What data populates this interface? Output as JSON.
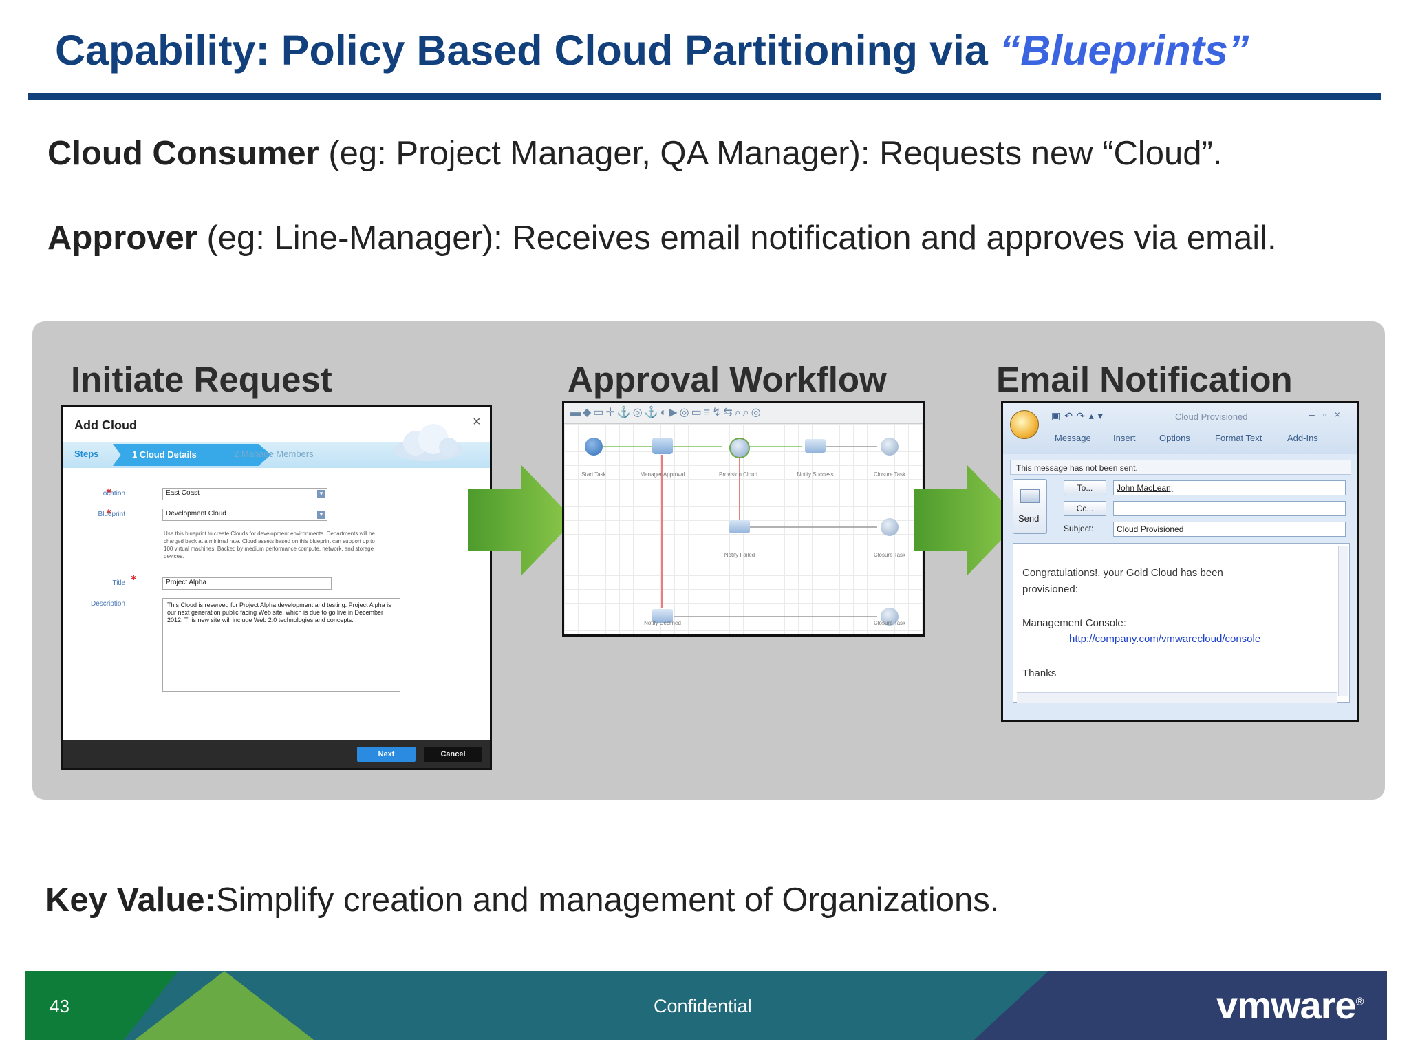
{
  "slide": {
    "title_main": "Capability: Policy Based Cloud Partitioning via ",
    "title_highlight": "“Blueprints”",
    "consumer_label": "Cloud Consumer",
    "consumer_text": " (eg: Project Manager, QA Manager): Requests new “Cloud”.",
    "approver_label": "Approver",
    "approver_text": " (eg: Line-Manager): Receives email notification and approves via email.",
    "key_label": "Key Value:",
    "key_text": "Simplify creation and management of Organizations."
  },
  "panels": {
    "initiate_title": "Initiate Request",
    "approval_title": "Approval Workflow",
    "email_title": "Email Notification"
  },
  "add_cloud": {
    "title": "Add Cloud",
    "close": "×",
    "steps_label": "Steps",
    "step1": "1 Cloud Details",
    "step2": "2 Manage Members",
    "location_label": "Location",
    "location_value": "East Coast",
    "blueprint_label": "Blueprint",
    "blueprint_value": "Development Cloud",
    "blueprint_help": "Use this blueprint to create Clouds for development environments. Departments will be charged back at a minimal rate. Cloud assets based on this blueprint can support up to 100 virtual machines. Backed by medium performance compute, network, and storage devices.",
    "title_label": "Title",
    "title_value": "Project Alpha",
    "description_label": "Description",
    "description_value": "This Cloud is reserved for Project Alpha development and testing. Project Alpha is our next generation public facing Web site, which is due to go live in December 2012. This new site will include Web 2.0 technologies and concepts.",
    "next": "Next",
    "cancel": "Cancel"
  },
  "workflow": {
    "toolbar_glyphs": "▬◆▭✛⚓◎⚓◐▶◎▭≡↯⇆⌕⌕◎",
    "nodes": [
      "Start Task",
      "Manager Approval",
      "Provision Cloud",
      "Notify Success",
      "Closure Task",
      "Notify Failed",
      "Closure Task",
      "Notify Declined",
      "Closure Task"
    ]
  },
  "email": {
    "window_title": "Cloud Provisioned",
    "tabs": [
      "Message",
      "Insert",
      "Options",
      "Format Text",
      "Add-Ins"
    ],
    "info": "This message has not been sent.",
    "send": "Send",
    "to_button": "To...",
    "cc_button": "Cc...",
    "to_value": "John MacLean;",
    "cc_value": "",
    "subject_label": "Subject:",
    "subject_value": "Cloud Provisioned",
    "body_line1": "Congratulations!, your Gold Cloud has been",
    "body_line2": "provisioned:",
    "body_line3": "Management Console:",
    "body_link": "http://company.com/vmwarecloud/console",
    "body_line4": "Thanks"
  },
  "footer": {
    "page_number": "43",
    "confidential": "Confidential",
    "logo": "vmware",
    "logo_mark": "®"
  },
  "colors": {
    "title_blue": "#12407c",
    "highlight_blue": "#3a64e0",
    "panel_gray": "#c9c8c9",
    "arrow_green": "#6db33f",
    "footer_green": "#0e7d3a",
    "footer_teal": "#216a7a",
    "footer_navy": "#2e3f6e"
  }
}
